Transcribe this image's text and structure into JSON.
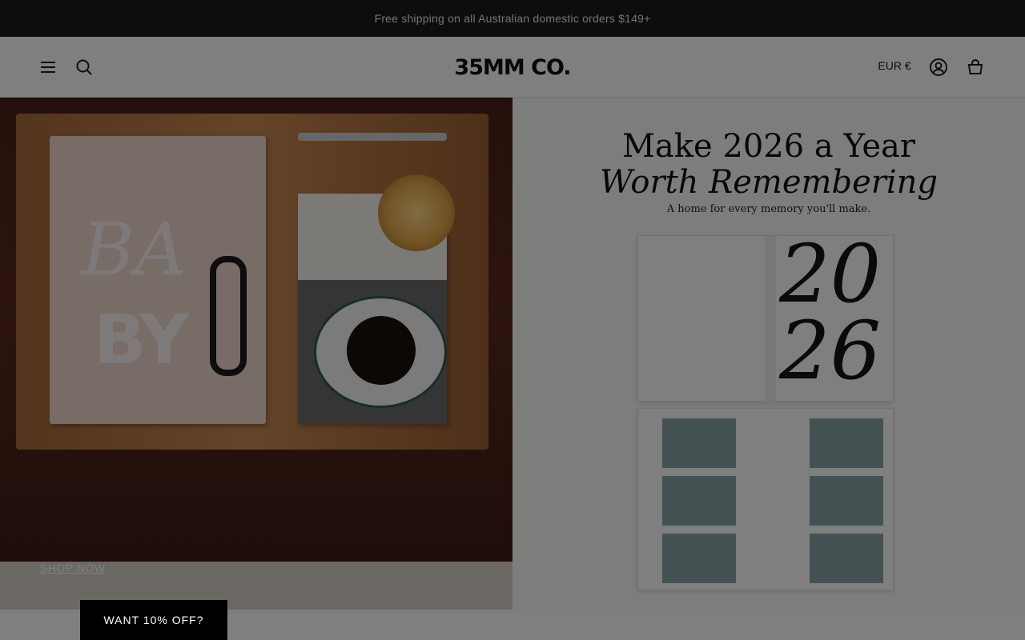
{
  "announcement": {
    "text": "Free shipping on all Australian domestic orders $149+"
  },
  "header": {
    "logo_text": "35MM CO.",
    "currency": "EUR €",
    "icons": {
      "menu": "hamburger-menu-icon",
      "search": "search-icon",
      "account": "account-icon",
      "cart": "cart-icon"
    }
  },
  "hero": {
    "left": {
      "image_text": {
        "script": "BA",
        "block": "BY"
      },
      "cta_label": "SHOP NOW"
    },
    "right": {
      "title_line1": "Make 2026 a Year",
      "title_line2": "Worth Remembering",
      "subtitle": "A home for every memory you'll make.",
      "album_number": "20 26"
    }
  },
  "promo": {
    "label": "WANT 10% OFF?"
  },
  "colors": {
    "announcement_bg": "#1b1b1b",
    "overlay": "rgba(0,0,0,0.5)",
    "promo_bg": "#000000"
  }
}
